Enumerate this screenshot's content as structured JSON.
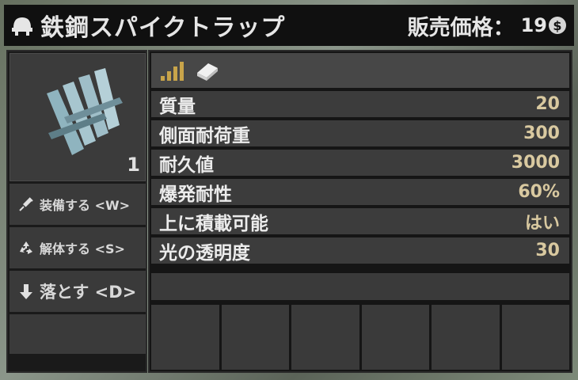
{
  "header": {
    "item_name": "鉄鋼スパイクトラップ",
    "price_label": "販売価格：",
    "price_value": "19",
    "currency_symbol": "$"
  },
  "preview": {
    "quantity": "1"
  },
  "actions": [
    {
      "label": "装備する <W>",
      "icon": "syringe-icon"
    },
    {
      "label": "解体する <S>",
      "icon": "recycle-icon"
    },
    {
      "label": "落とす <D>",
      "icon": "arrow-down-icon"
    }
  ],
  "info_icons": [
    "quality-bars-icon",
    "book-icon"
  ],
  "stats": [
    {
      "label": "質量",
      "value": "20"
    },
    {
      "label": "側面耐荷重",
      "value": "300"
    },
    {
      "label": "耐久値",
      "value": "3000"
    },
    {
      "label": "爆発耐性",
      "value": "60%"
    },
    {
      "label": "上に積載可能",
      "value": "はい"
    },
    {
      "label": "光の透明度",
      "value": "30"
    }
  ],
  "colors": {
    "stat_value": "#d9c9a0",
    "quality_icon": "#c8a44a",
    "panel_dark": "#151515",
    "row_bg": "#3c3c3c"
  }
}
